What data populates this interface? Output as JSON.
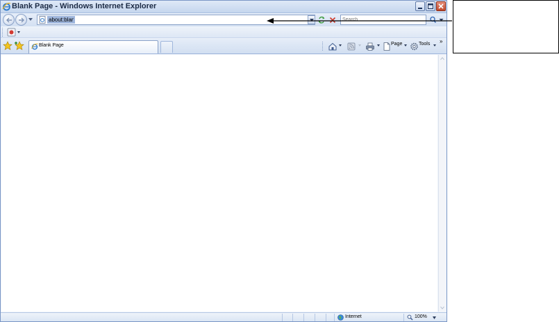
{
  "window": {
    "title": "Blank Page - Windows Internet Explorer"
  },
  "address": {
    "url": "about:blank"
  },
  "search": {
    "placeholder": "Search"
  },
  "tabs": [
    {
      "label": "Blank Page",
      "selected": true
    }
  ],
  "command_bar": {
    "page_label": "Page",
    "tools_label": "Tools",
    "overflow": "»"
  },
  "status": {
    "zone": "Internet",
    "zoom": "100%"
  },
  "colors": {
    "frame_border": "#7a96c6",
    "chrome_light": "#eef3fa",
    "close_red": "#c0482b",
    "annotation": "#000000"
  },
  "icons": {
    "title": "ie-logo-icon",
    "back": "back-arrow-icon",
    "forward": "forward-arrow-icon",
    "refresh": "refresh-icon",
    "stop": "stop-icon",
    "search": "magnifier-icon",
    "favorites": "star-icon",
    "add_favorites": "star-plus-icon",
    "home": "home-icon",
    "feeds": "feeds-icon",
    "print": "printer-icon",
    "page": "page-icon",
    "tools": "gear-icon",
    "zone": "globe-icon",
    "zoom": "zoom-icon"
  }
}
